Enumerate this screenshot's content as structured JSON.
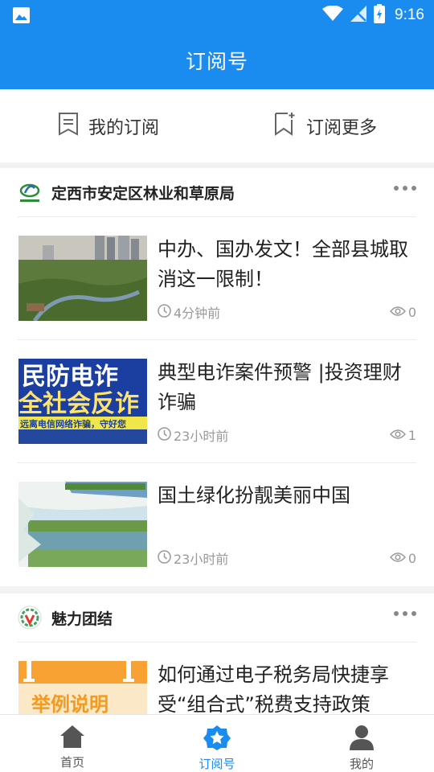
{
  "status_bar": {
    "time": "9:16"
  },
  "app_bar": {
    "title": "订阅号"
  },
  "tabs": [
    {
      "label": "我的订阅"
    },
    {
      "label": "订阅更多"
    }
  ],
  "channels": [
    {
      "name": "定西市安定区林业和草原局",
      "articles": [
        {
          "title": "中办、国办发文！全部县城取消这一限制！",
          "time": "4分钟前",
          "views": "0"
        },
        {
          "title": "典型电诈案件预警 |投资理财诈骗",
          "time": "23小时前",
          "views": "1",
          "thumb_text_1": "民防电诈",
          "thumb_text_2": "全社会反诈",
          "thumb_text_3": "远离电信网络诈骗，守好您"
        },
        {
          "title": "国土绿化扮靓美丽中国",
          "time": "23小时前",
          "views": "0"
        }
      ]
    },
    {
      "name": "魅力团结",
      "articles": [
        {
          "title": "如何通过电子税务局快捷享受“组合式”税费支持政策",
          "thumb_text": "举例说明"
        }
      ]
    }
  ],
  "bottom_nav": [
    {
      "label": "首页"
    },
    {
      "label": "订阅号"
    },
    {
      "label": "我的"
    }
  ],
  "colors": {
    "primary": "#1a8cf0",
    "meta": "#999999"
  }
}
